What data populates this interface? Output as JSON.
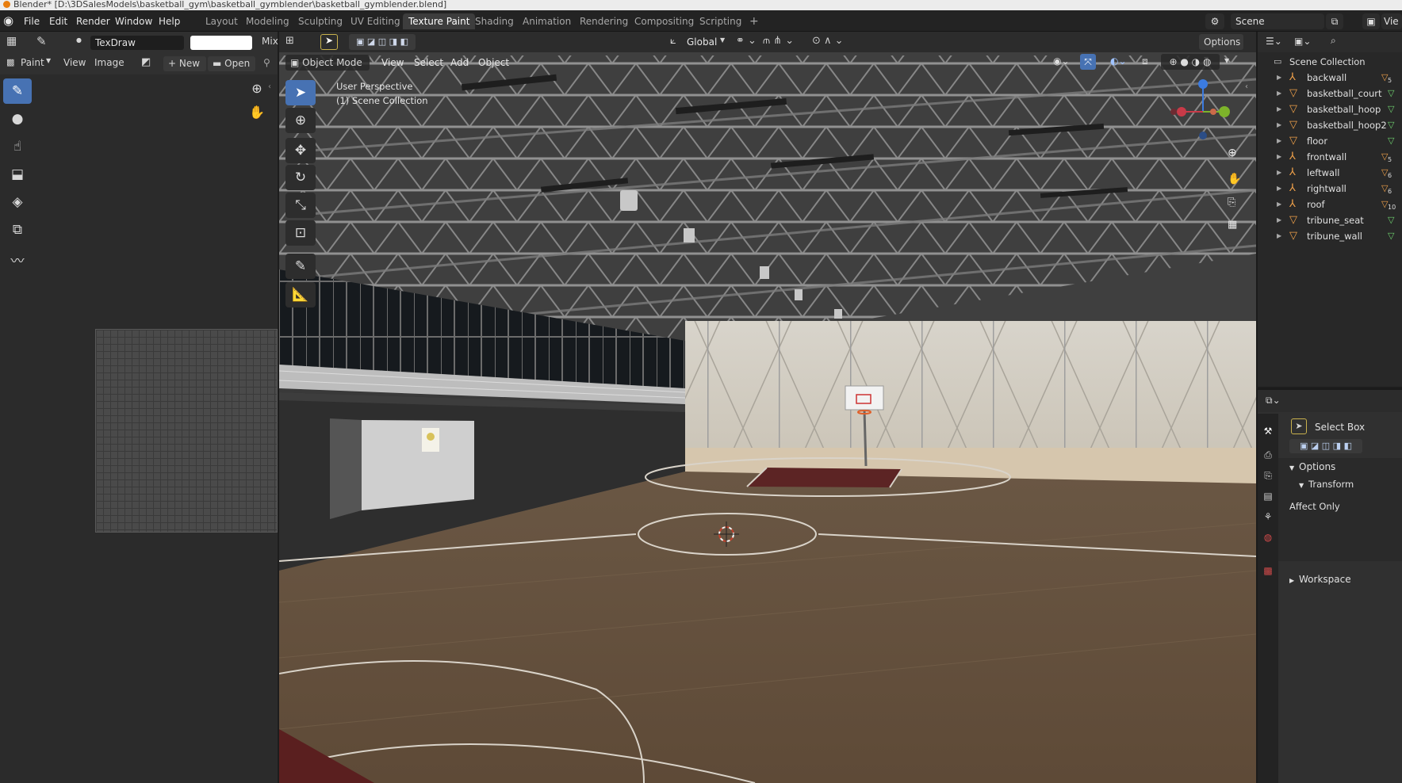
{
  "window_title": "Blender* [D:\\3DSalesModels\\basketball_gym\\basketball_gymblender\\basketball_gymblender.blend]",
  "menu": [
    "File",
    "Edit",
    "Render",
    "Window",
    "Help"
  ],
  "workspaces": [
    "Layout",
    "Modeling",
    "Sculpting",
    "UV Editing",
    "Texture Paint",
    "Shading",
    "Animation",
    "Rendering",
    "Compositing",
    "Scripting"
  ],
  "active_workspace": "Texture Paint",
  "add_workspace": "+",
  "scene_name": "Scene",
  "view_layer_partial": "Vie",
  "image_editor": {
    "brush_name": "TexDraw",
    "blend_mode": "Mix",
    "mode": "Paint",
    "menus": [
      "View",
      "Image"
    ],
    "new_label": "New",
    "open_label": "Open"
  },
  "viewport": {
    "mode": "Object Mode",
    "menus": [
      "View",
      "Select",
      "Add",
      "Object"
    ],
    "orientation": "Global",
    "options_label": "Options",
    "perspective_label": "User Perspective",
    "collection_label": "(1) Scene Collection"
  },
  "outliner": {
    "root": "Scene Collection",
    "items": [
      {
        "name": "backwall",
        "type": "empty",
        "badge": "5"
      },
      {
        "name": "basketball_court",
        "type": "mesh",
        "badge": ""
      },
      {
        "name": "basketball_hoop",
        "type": "mesh",
        "badge": ""
      },
      {
        "name": "basketball_hoop2",
        "type": "mesh",
        "badge": ""
      },
      {
        "name": "floor",
        "type": "mesh",
        "badge": ""
      },
      {
        "name": "frontwall",
        "type": "empty",
        "badge": "5"
      },
      {
        "name": "leftwall",
        "type": "empty",
        "badge": "6"
      },
      {
        "name": "rightwall",
        "type": "empty",
        "badge": "6"
      },
      {
        "name": "roof",
        "type": "empty",
        "badge": "10"
      },
      {
        "name": "tribune_seat",
        "type": "mesh",
        "badge": ""
      },
      {
        "name": "tribune_wall",
        "type": "mesh",
        "badge": ""
      }
    ]
  },
  "properties": {
    "tool_name": "Select Box",
    "options_label": "Options",
    "transform_label": "Transform",
    "affect_only_label": "Affect Only",
    "workspace_label": "Workspace"
  }
}
